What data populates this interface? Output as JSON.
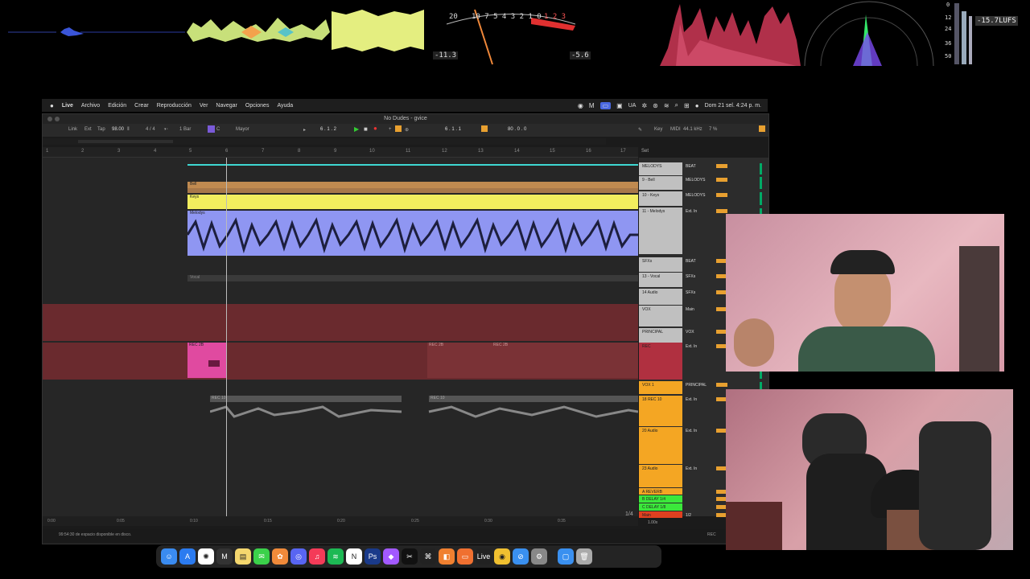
{
  "meters": {
    "vu_scale_left": "20",
    "vu_scale_mid": "10 7 5 4 3 2 1 0",
    "vu_scale_right": "1 2 3",
    "vu_left_value": "-11.3",
    "vu_right_value": "-5.6",
    "loudness_scale": [
      "0",
      "12",
      "24",
      "36",
      "50"
    ],
    "lufs_readout": "-15.7LUFS"
  },
  "menubar": {
    "app": "Live",
    "items": [
      "Archivo",
      "Edición",
      "Crear",
      "Reproducción",
      "Ver",
      "Navegar",
      "Opciones",
      "Ayuda"
    ],
    "lang": "UA",
    "datetime": "Dom 21 sel. 4:24 p. m."
  },
  "live": {
    "title": "No Dudes - gvice",
    "control": {
      "link": "Link",
      "ext": "Ext",
      "tap": "Tap",
      "tempo": "98.00",
      "signature": "4 / 4",
      "quantize": "1 Bar",
      "key": "C",
      "scale": "Mayor",
      "position": "6 . 1 . 2",
      "loop_start": "6 . 1 . 1",
      "loop_len": "80 . 0 . 0",
      "key_label": "Key",
      "midi_label": "MIDI",
      "samplerate": "44.1 kHz",
      "cpu": "7 %"
    },
    "ruler_bars": [
      "1",
      "2",
      "3",
      "4",
      "5",
      "6",
      "7",
      "8",
      "9",
      "10",
      "11",
      "12",
      "13",
      "14",
      "15",
      "16",
      "17"
    ],
    "set_label": "Set",
    "time_ticks": [
      "0:00",
      "0:05",
      "0:10",
      "0:15",
      "0:20",
      "0:25",
      "0:30",
      "0:35"
    ],
    "clips": {
      "bell": "Bell",
      "keys": "Keys",
      "melodys": "Melodys",
      "vocal": "Vocal",
      "rec_a": "REC 2B",
      "rec_b": "REC 2B",
      "rec_c": "REC 2B",
      "rec10_a": "REC 10",
      "rec10_b": "REC 10"
    },
    "mixer_tracks": [
      {
        "name": "MELODYS",
        "route": "BEAT"
      },
      {
        "name": "9 - Bell",
        "route": "MELODYS"
      },
      {
        "name": "10 - Keys",
        "route": "MELODYS"
      },
      {
        "name": "11 - Melodys",
        "route": "Ext. In"
      },
      {
        "name": "SFXs",
        "route": "BEAT"
      },
      {
        "name": "13 - Vocal",
        "route": "SFXs"
      },
      {
        "name": "14 Audio",
        "route": "SFXs"
      },
      {
        "name": "VOX",
        "route": "Main"
      },
      {
        "name": "PRINCIPAL",
        "route": "VOX"
      },
      {
        "name": "REC",
        "route": "Ext. In"
      },
      {
        "name": "VOX 1",
        "route": "PRINCIPAL"
      },
      {
        "name": "18 REC 10",
        "route": "Ext. In"
      },
      {
        "name": "20 Audio",
        "route": "Ext. In"
      },
      {
        "name": "23 Audio",
        "route": "Ext. In"
      },
      {
        "name": "A REVERB",
        "route": ""
      },
      {
        "name": "B DELAY 1/4",
        "route": ""
      },
      {
        "name": "C DELAY 1/8",
        "route": ""
      },
      {
        "name": "Main",
        "route": "1/2"
      }
    ],
    "page_count": "1/4",
    "zoom": "1.00x",
    "status_text": "99:54:30 de espacio disponible en disco.",
    "rec_label": "REC"
  },
  "dock": {
    "apps": [
      "Finder",
      "App Store",
      "ChatGPT",
      "Max",
      "Notes",
      "Messages",
      "Photos",
      "Discord",
      "Music",
      "Spotify",
      "Notion",
      "Photoshop",
      "Figma",
      "CapCut",
      "Scripts",
      "Capture",
      "Pages",
      "Live",
      "Chrome",
      "Safari",
      "Settings",
      "Downloads",
      "Trash"
    ]
  },
  "colors": {
    "bell": "#c08a50",
    "keys": "#f2ee5e",
    "melodys": "#8f96f2",
    "vox_group": "#6a2a2e",
    "rec_clip": "#e04aa0",
    "orange": "#f4a623",
    "green": "#3be83b",
    "teal_line": "#3ed7d2"
  }
}
